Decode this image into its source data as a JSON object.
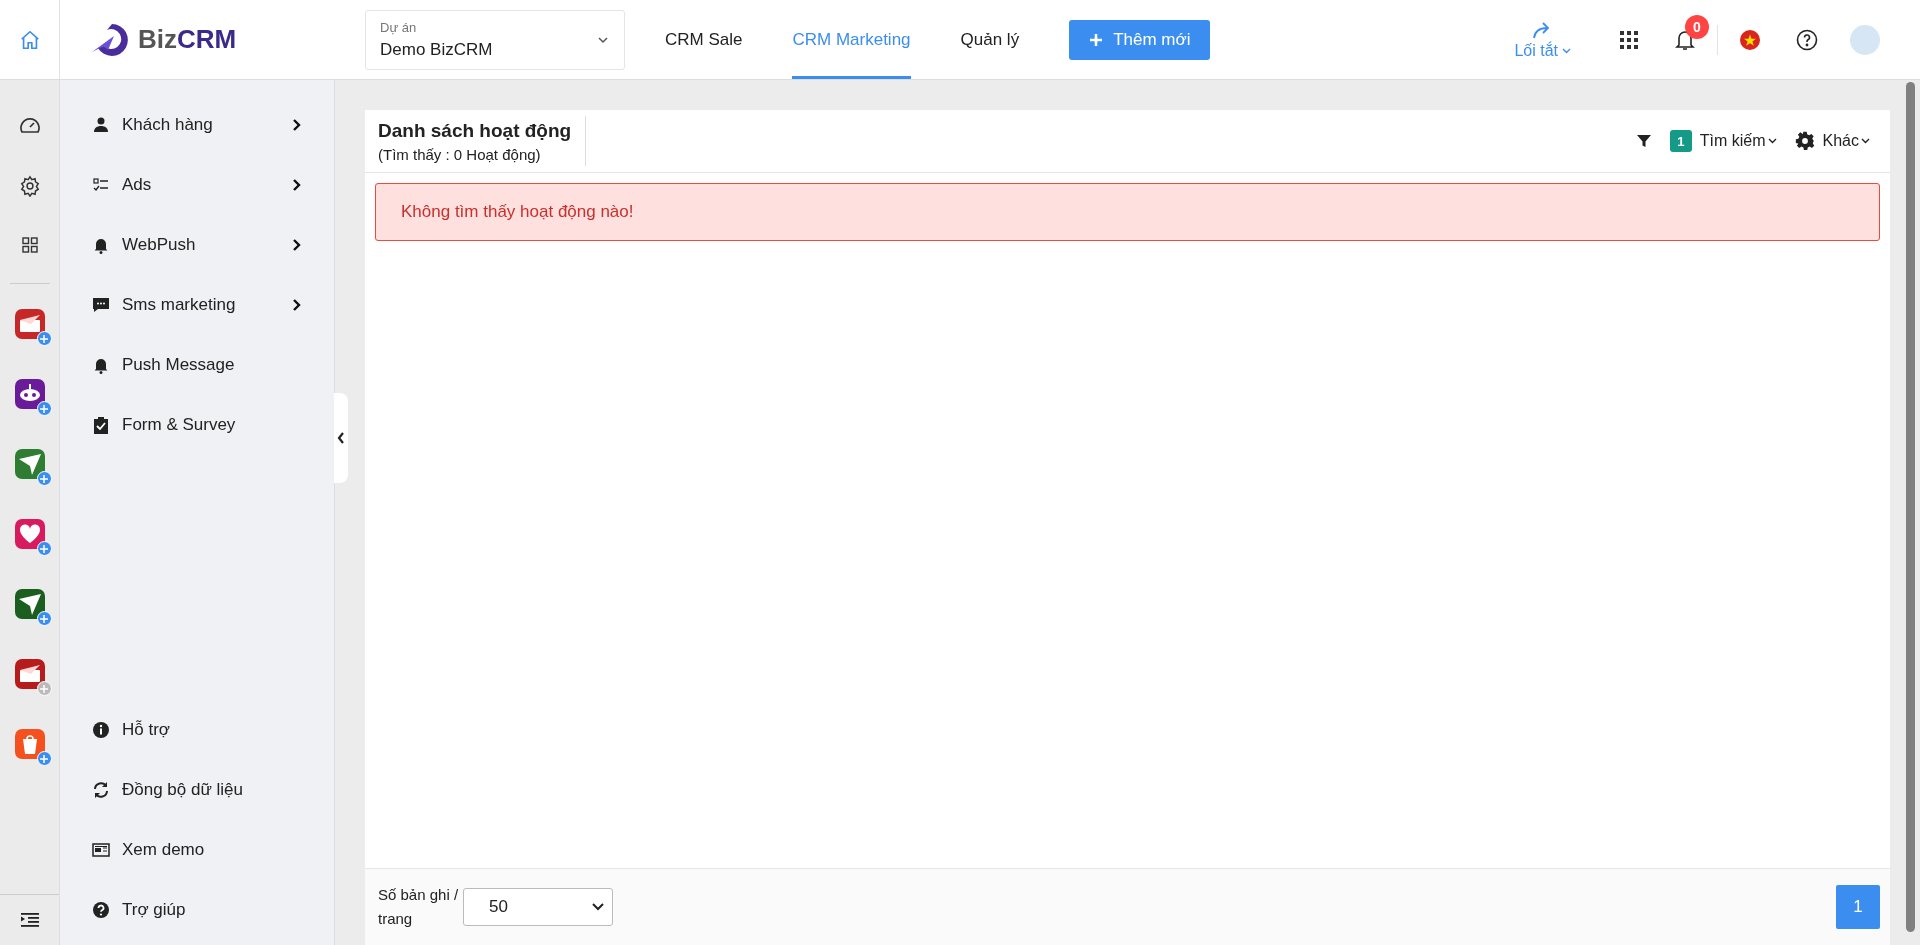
{
  "topbar": {
    "logo": {
      "first": "Biz",
      "second": "CRM"
    },
    "project": {
      "label": "Dự án",
      "value": "Demo BizCRM"
    },
    "nav": [
      {
        "label": "CRM Sale",
        "selected": false
      },
      {
        "label": "CRM Marketing",
        "selected": true
      },
      {
        "label": "Quản lý",
        "selected": false
      }
    ],
    "add_button": "Thêm mới",
    "shortcut": "Lối tắt",
    "notifications": "0"
  },
  "rail": {
    "apps": [
      {
        "kind": "mail",
        "color": "#c62828",
        "installed": true
      },
      {
        "kind": "bot",
        "color": "#6a1b9a",
        "installed": true
      },
      {
        "kind": "plane",
        "color": "#2e7d32",
        "installed": true
      },
      {
        "kind": "heart",
        "color": "#d81b60",
        "installed": true
      },
      {
        "kind": "plane",
        "color": "#1b5e20",
        "installed": true
      },
      {
        "kind": "mail",
        "color": "#b71c1c",
        "installed": false
      },
      {
        "kind": "bag",
        "color": "#f4511e",
        "installed": true
      }
    ]
  },
  "sidebar": {
    "items": [
      {
        "kind": "person",
        "label": "Khách hàng",
        "has_submenu": true
      },
      {
        "kind": "checklist",
        "label": "Ads",
        "has_submenu": true
      },
      {
        "kind": "bell",
        "label": "WebPush",
        "has_submenu": true
      },
      {
        "kind": "chat",
        "label": "Sms marketing",
        "has_submenu": true
      },
      {
        "kind": "bell",
        "label": "Push Message",
        "has_submenu": false
      },
      {
        "kind": "clipboard",
        "label": "Form & Survey",
        "has_submenu": false
      }
    ],
    "bottom_items": [
      {
        "kind": "info",
        "label": "Hỗ trợ"
      },
      {
        "kind": "sync",
        "label": "Đồng bộ dữ liệu"
      },
      {
        "kind": "news",
        "label": "Xem demo"
      },
      {
        "kind": "help",
        "label": "Trợ giúp"
      }
    ]
  },
  "content": {
    "title": "Danh sách hoạt động",
    "subtitle": "(Tìm thấy : 0 Hoạt động)",
    "filter_count": "1",
    "search": "Tìm kiếm",
    "more": "Khác",
    "alert": "Không tìm thấy hoạt động nào!",
    "footer": {
      "page_size_label": "Số bản ghi / trang",
      "page_size": "50",
      "pages": [
        {
          "label": "1",
          "selected": true
        }
      ]
    }
  }
}
